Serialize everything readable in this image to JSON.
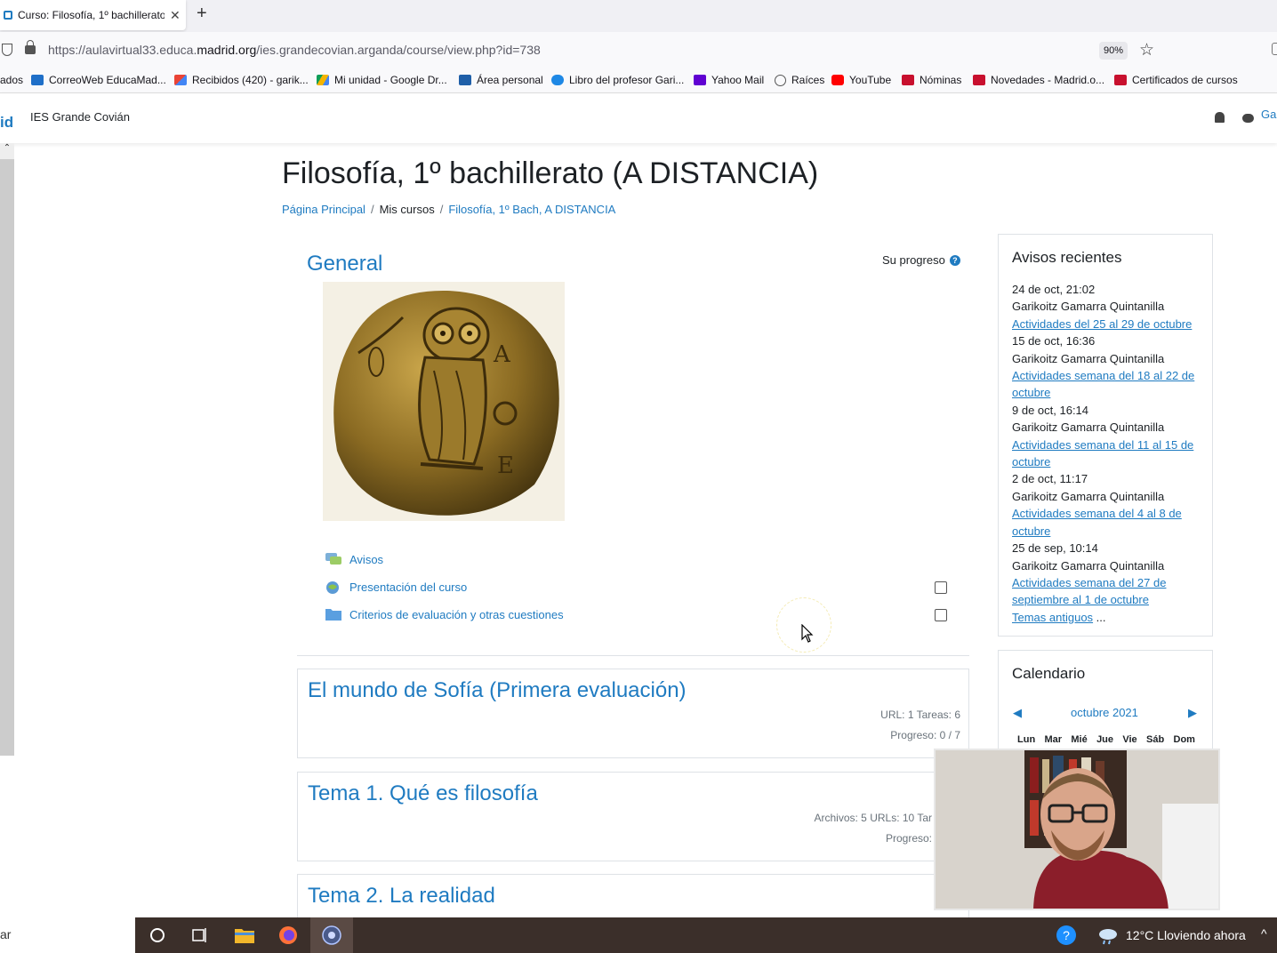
{
  "browser": {
    "tab_title": "Curso: Filosofía, 1º bachillerato",
    "url_prefix": "https://aulavirtual33.educa.",
    "url_domain": "madrid.org",
    "url_path": "/ies.grandecovian.arganda/course/view.php?id=738",
    "zoom": "90%",
    "bookmarks": [
      {
        "label": "ados",
        "icon": "folder-icon"
      },
      {
        "label": "CorreoWeb EducaMad...",
        "icon": "mail-icon"
      },
      {
        "label": "Recibidos (420) - garik...",
        "icon": "gmail-icon"
      },
      {
        "label": "Mi unidad - Google Dr...",
        "icon": "google-drive-icon"
      },
      {
        "label": "Área personal",
        "icon": "graduation-cap-icon"
      },
      {
        "label": "Libro del profesor Gari...",
        "icon": "cloud-icon"
      },
      {
        "label": "Yahoo Mail",
        "icon": "yahoo-mail-icon"
      },
      {
        "label": "Raíces",
        "icon": "globe-icon"
      },
      {
        "label": "YouTube",
        "icon": "youtube-icon"
      },
      {
        "label": "Nóminas",
        "icon": "madrid-icon"
      },
      {
        "label": "Novedades - Madrid.o...",
        "icon": "madrid-icon"
      },
      {
        "label": "Certificados de cursos",
        "icon": "madrid-icon"
      }
    ]
  },
  "header": {
    "brand_fragment": "id",
    "site_name": "IES Grande Covián",
    "user_fragment": "Ga"
  },
  "page": {
    "title": "Filosofía, 1º bachillerato (A DISTANCIA)",
    "breadcrumb": [
      "Página Principal",
      "Mis cursos",
      "Filosofía, 1º Bach, A DISTANCIA"
    ]
  },
  "general": {
    "title": "General",
    "progress_label": "Su progreso",
    "activities": [
      {
        "label": "Avisos",
        "icon": "forum-icon",
        "has_checkbox": false
      },
      {
        "label": "Presentación del curso",
        "icon": "url-icon",
        "has_checkbox": true
      },
      {
        "label": "Criterios de evaluación y otras cuestiones",
        "icon": "folder-icon",
        "has_checkbox": true
      }
    ]
  },
  "sections": [
    {
      "title": "El mundo de Sofía (Primera evaluación)",
      "meta": "URL: 1  Tareas: 6",
      "progress": "Progreso: 0 / 7"
    },
    {
      "title": "Tema 1. Qué es filosofía",
      "meta": "Archivos: 5  URLs: 10  Tar",
      "progress": "Progreso: "
    },
    {
      "title": "Tema 2. La realidad",
      "meta": "",
      "progress": ""
    }
  ],
  "news_block": {
    "title": "Avisos recientes",
    "items": [
      {
        "date": "24 de oct, 21:02",
        "author": "Garikoitz Gamarra Quintanilla",
        "subject": "Actividades del 25 al 29 de octubre"
      },
      {
        "date": "15 de oct, 16:36",
        "author": "Garikoitz Gamarra Quintanilla",
        "subject": "Actividades semana del 18 al 22 de octubre"
      },
      {
        "date": "9 de oct, 16:14",
        "author": "Garikoitz Gamarra Quintanilla",
        "subject": "Actividades semana del 11 al 15 de octubre"
      },
      {
        "date": "2 de oct, 11:17",
        "author": "Garikoitz Gamarra Quintanilla",
        "subject": "Actividades semana del 4 al 8 de octubre"
      },
      {
        "date": "25 de sep, 10:14",
        "author": "Garikoitz Gamarra Quintanilla",
        "subject": "Actividades semana del 27 de septiembre al 1 de octubre"
      }
    ],
    "older_link": "Temas antiguos",
    "older_suffix": " ..."
  },
  "calendar_block": {
    "title": "Calendario",
    "month": "octubre 2021",
    "prev": "◀",
    "next": "▶",
    "days": [
      "Lun",
      "Mar",
      "Mié",
      "Jue",
      "Vie",
      "Sáb",
      "Dom"
    ]
  },
  "taskbar": {
    "search_fragment": "ar",
    "weather": "12°C  Lloviendo ahora"
  },
  "colors": {
    "accent": "#1f7bc1",
    "taskbar": "#3b2f2a"
  }
}
